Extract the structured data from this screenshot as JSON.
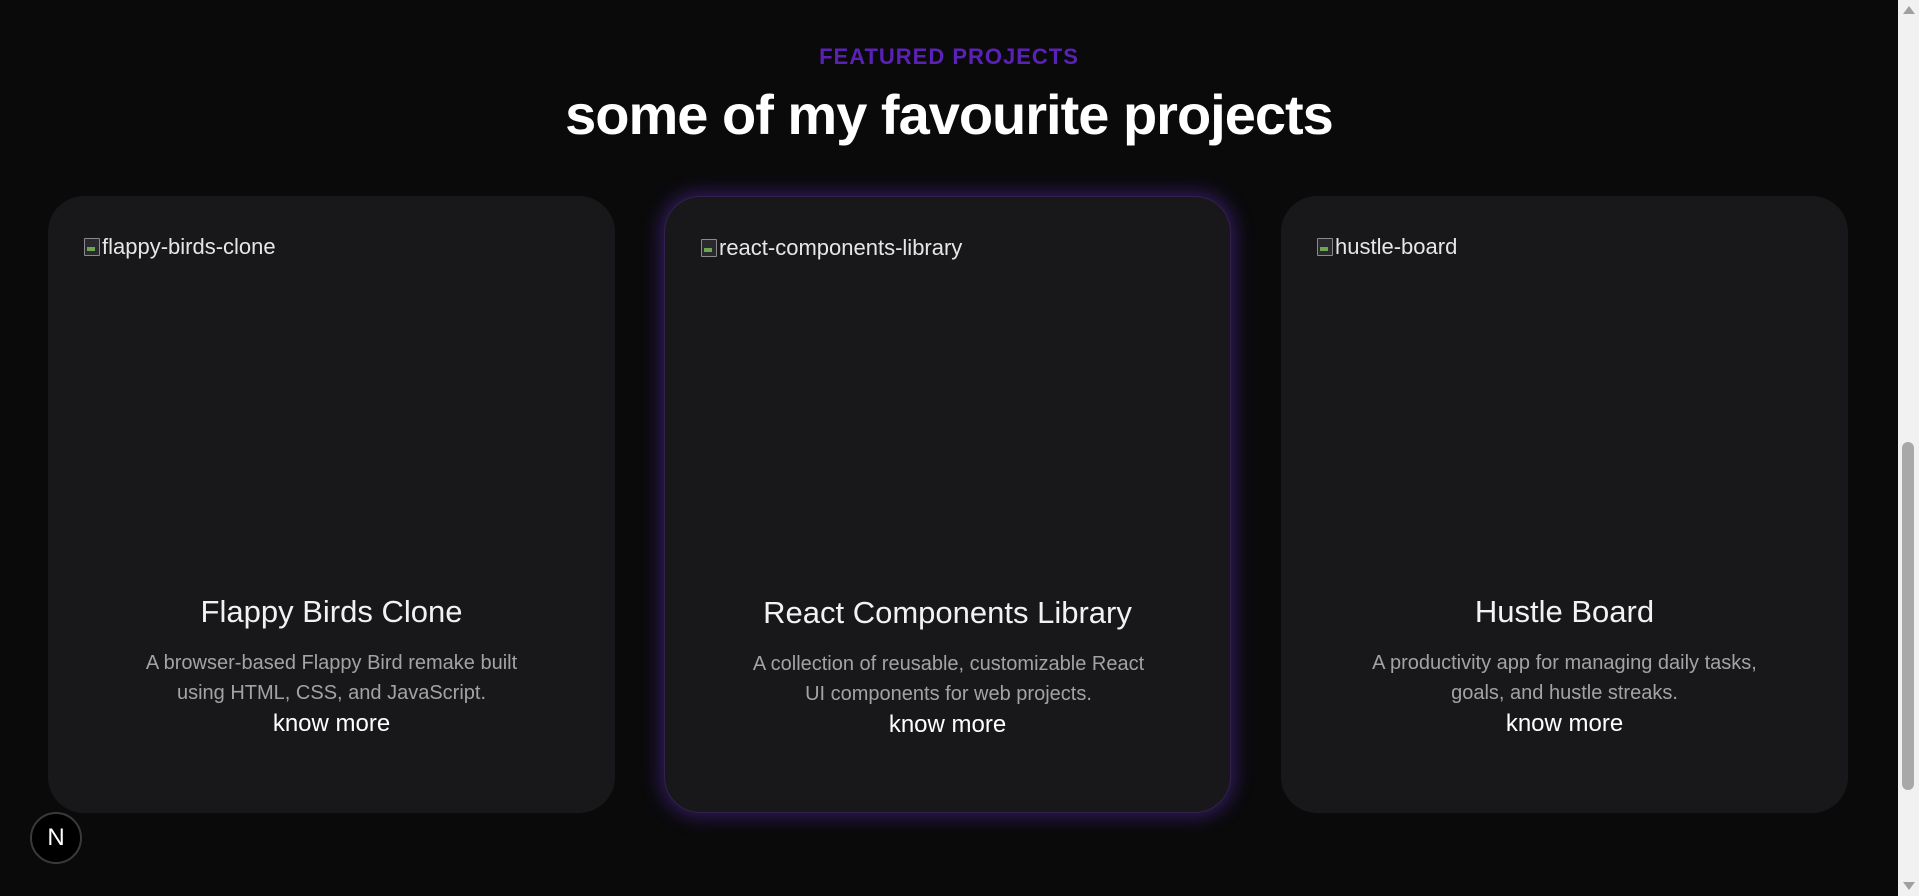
{
  "header": {
    "eyebrow": "FEATURED PROJECTS",
    "title": "some of my favourite projects"
  },
  "colors": {
    "accent": "#5b21b6",
    "background": "#0a0a0b",
    "card": "#18181b"
  },
  "projects": [
    {
      "image_alt": "flappy-birds-clone",
      "title": "Flappy Birds Clone",
      "description": "A browser-based Flappy Bird remake built using HTML, CSS, and JavaScript.",
      "link_label": "know more"
    },
    {
      "image_alt": "react-components-library",
      "title": "React Components Library",
      "description": "A collection of reusable, customizable React UI components for web projects.",
      "link_label": "know more",
      "highlighted": true
    },
    {
      "image_alt": "hustle-board",
      "title": "Hustle Board",
      "description": "A productivity app for managing daily tasks, goals, and hustle streaks.",
      "link_label": "know more"
    }
  ],
  "badge": {
    "letter": "N"
  }
}
